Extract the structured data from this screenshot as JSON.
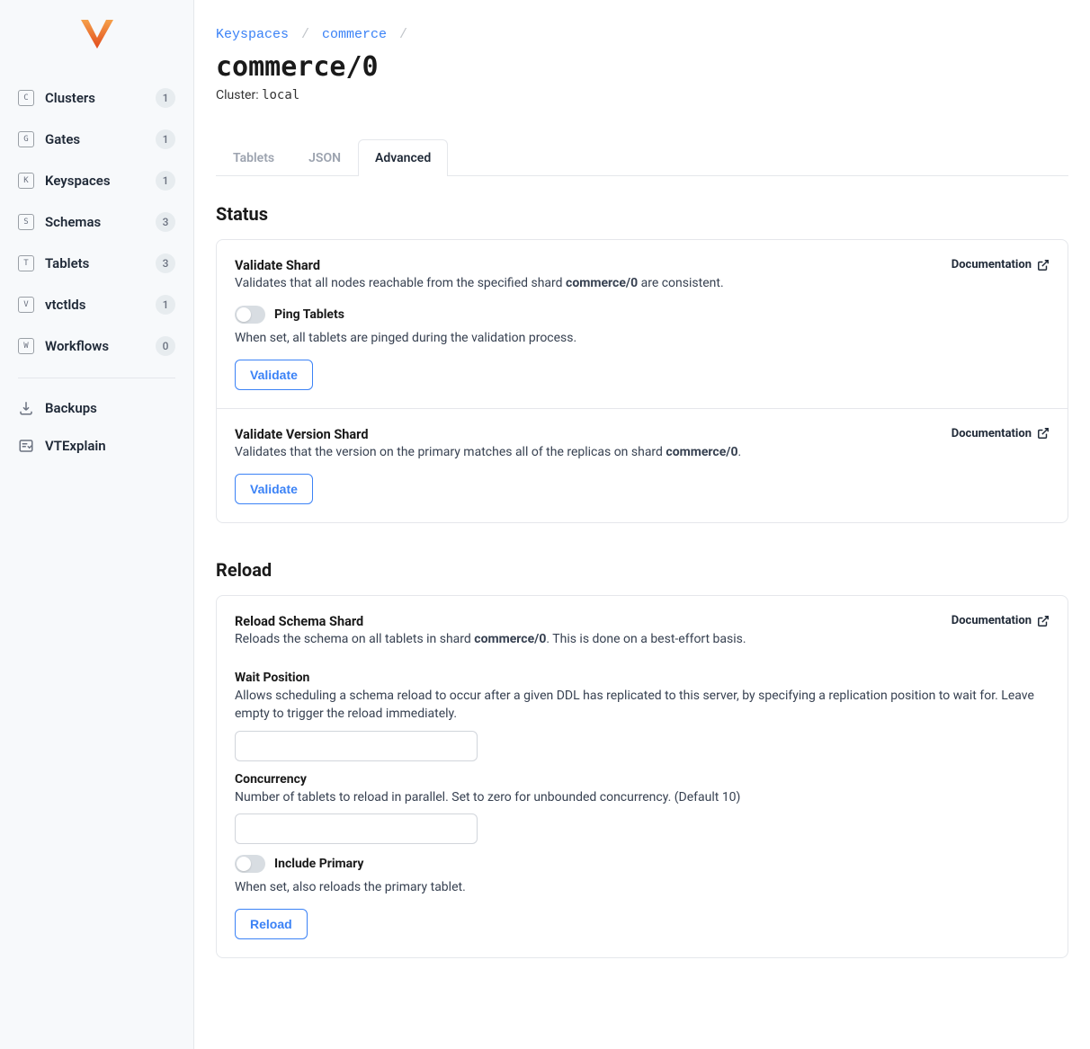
{
  "sidebar": {
    "items": [
      {
        "icon": "C",
        "label": "Clusters",
        "badge": "1"
      },
      {
        "icon": "G",
        "label": "Gates",
        "badge": "1"
      },
      {
        "icon": "K",
        "label": "Keyspaces",
        "badge": "1"
      },
      {
        "icon": "S",
        "label": "Schemas",
        "badge": "3"
      },
      {
        "icon": "T",
        "label": "Tablets",
        "badge": "3"
      },
      {
        "icon": "V",
        "label": "vtctlds",
        "badge": "1"
      },
      {
        "icon": "W",
        "label": "Workflows",
        "badge": "0"
      }
    ],
    "secondary": [
      {
        "label": "Backups"
      },
      {
        "label": "VTExplain"
      }
    ]
  },
  "breadcrumb": {
    "keyspaces": "Keyspaces",
    "commerce": "commerce"
  },
  "page": {
    "title": "commerce/0",
    "cluster_label": "Cluster: ",
    "cluster_value": "local"
  },
  "tabs": {
    "tablets": "Tablets",
    "json": "JSON",
    "advanced": "Advanced"
  },
  "status": {
    "heading": "Status",
    "validate_shard": {
      "title": "Validate Shard",
      "desc_pre": "Validates that all nodes reachable from the specified shard ",
      "desc_strong": "commerce/0",
      "desc_post": " are consistent.",
      "doc_link": "Documentation",
      "toggle_label": "Ping Tablets",
      "toggle_help": "When set, all tablets are pinged during the validation process.",
      "button": "Validate"
    },
    "validate_version": {
      "title": "Validate Version Shard",
      "desc_pre": "Validates that the version on the primary matches all of the replicas on shard ",
      "desc_strong": "commerce/0",
      "desc_post": ".",
      "doc_link": "Documentation",
      "button": "Validate"
    }
  },
  "reload": {
    "heading": "Reload",
    "schema": {
      "title": "Reload Schema Shard",
      "desc_pre": "Reloads the schema on all tablets in shard ",
      "desc_strong": "commerce/0",
      "desc_post": ". This is done on a best-effort basis.",
      "doc_link": "Documentation",
      "wait_label": "Wait Position",
      "wait_help": "Allows scheduling a schema reload to occur after a given DDL has replicated to this server, by specifying a replication position to wait for. Leave empty to trigger the reload immediately.",
      "concurrency_label": "Concurrency",
      "concurrency_help": "Number of tablets to reload in parallel. Set to zero for unbounded concurrency. (Default 10)",
      "include_label": "Include Primary",
      "include_help": "When set, also reloads the primary tablet.",
      "button": "Reload"
    }
  }
}
